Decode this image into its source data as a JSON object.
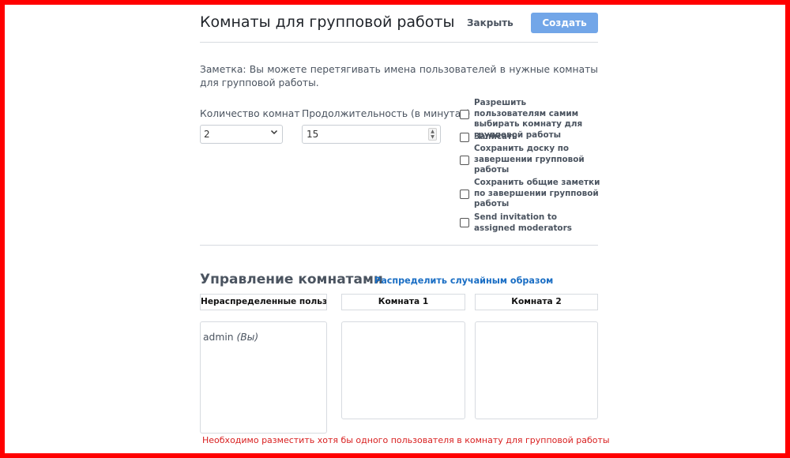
{
  "header": {
    "title": "Комнаты для групповой работы",
    "close_label": "Закрыть",
    "create_label": "Создать"
  },
  "note": "Заметка: Вы можете перетягивать имена пользователей в нужные комнаты для групповой работы.",
  "settings": {
    "room_count_label": "Количество комнат",
    "room_count_value": "2",
    "duration_label": "Продолжительность (в минутах)",
    "duration_value": "15"
  },
  "options": [
    {
      "label": "Разрешить пользователям самим выбирать комнату для групповой работы",
      "checked": false
    },
    {
      "label": "Записать",
      "checked": false
    },
    {
      "label": "Сохранить доску по завершении групповой работы",
      "checked": false
    },
    {
      "label": "Сохранить общие заметки по завершении групповой работы",
      "checked": false
    },
    {
      "label": "Send invitation to assigned moderators",
      "checked": false
    }
  ],
  "room_management": {
    "title": "Управление комнатами",
    "randomize_label": "Распределить случайным образом",
    "columns": [
      {
        "header": "Нераспределенные пользова",
        "users": [
          {
            "name": "admin",
            "suffix": "(Вы)"
          }
        ]
      },
      {
        "header": "Комната 1",
        "users": []
      },
      {
        "header": "Комната 2",
        "users": []
      }
    ]
  },
  "error_message": "Необходимо разместить хотя бы одного пользователя в комнату для групповой работы",
  "colors": {
    "accent": "#72a6e8",
    "link": "#1a6ec4",
    "error": "#d92020",
    "frame": "#ff0000"
  }
}
